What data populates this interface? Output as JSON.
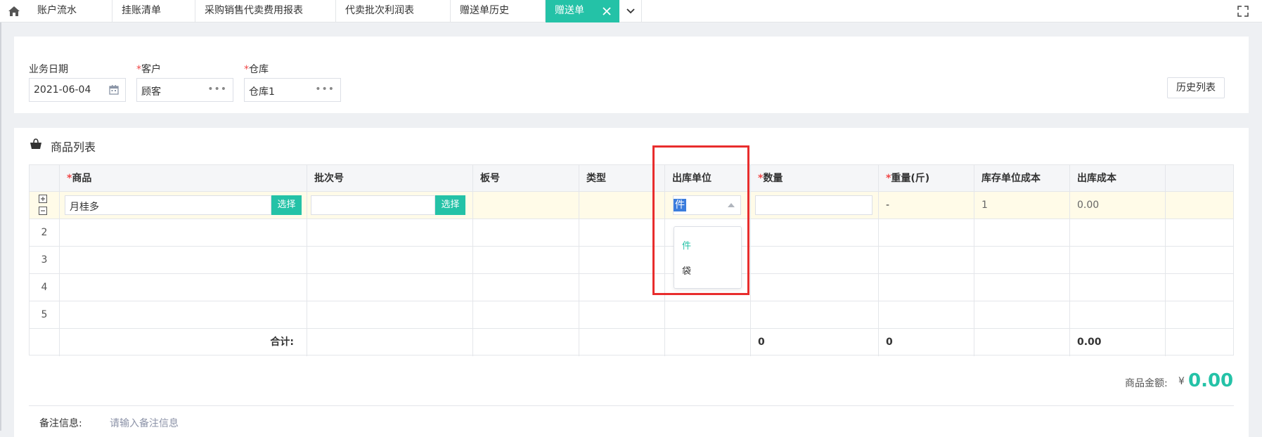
{
  "tabs": [
    {
      "label": "账户流水"
    },
    {
      "label": "挂账清单"
    },
    {
      "label": "采购销售代卖费用报表"
    },
    {
      "label": "代卖批次利润表"
    },
    {
      "label": "赠送单历史"
    },
    {
      "label": "赠送单",
      "active": true
    }
  ],
  "form": {
    "date_label": "业务日期",
    "date_value": "2021-06-04",
    "customer_label": "客户",
    "customer_value": "顾客",
    "warehouse_label": "仓库",
    "warehouse_value": "仓库1",
    "required_mark": "*",
    "dots": "•••",
    "history_button": "历史列表"
  },
  "product_list": {
    "title": "商品列表",
    "headers": {
      "product": "商品",
      "batch": "批次号",
      "board": "板号",
      "type": "类型",
      "unit": "出库单位",
      "qty": "数量",
      "weight": "重量(斤)",
      "stock_cost": "库存单位成本",
      "out_cost": "出库成本"
    },
    "row1": {
      "product": "月桂多",
      "pick_label": "选择",
      "batch": "",
      "unit": "件",
      "weight": "-",
      "stock_cost": "1",
      "out_cost": "0.00"
    },
    "row_numbers": [
      "2",
      "3",
      "4",
      "5"
    ],
    "total": {
      "label": "合计:",
      "qty": "0",
      "weight": "0",
      "out_cost": "0.00"
    }
  },
  "unit_dropdown": {
    "options": [
      "件",
      "袋"
    ],
    "selected": "件"
  },
  "amount": {
    "label": "商品金额:",
    "currency": "¥",
    "value": "0.00"
  },
  "notes": {
    "label": "备注信息:",
    "placeholder": "请输入备注信息"
  },
  "colors": {
    "accent": "#24c2a7",
    "required": "#f04848",
    "highlight_box": "#e82d2d",
    "selected_row": "#fffbe8"
  }
}
